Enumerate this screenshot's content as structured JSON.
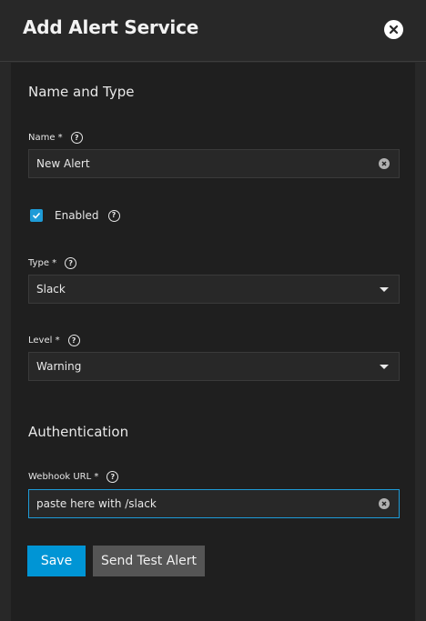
{
  "header": {
    "title": "Add Alert Service",
    "close_icon": "close-icon"
  },
  "sections": {
    "name_type": "Name and Type",
    "authentication": "Authentication"
  },
  "fields": {
    "name": {
      "label": "Name *",
      "value": "New Alert"
    },
    "enabled": {
      "label": "Enabled",
      "checked": true
    },
    "type": {
      "label": "Type *",
      "value": "Slack"
    },
    "level": {
      "label": "Level *",
      "value": "Warning"
    },
    "webhook": {
      "label": "Webhook URL *",
      "value": "paste here with /slack"
    }
  },
  "buttons": {
    "save": "Save",
    "test": "Send Test Alert"
  },
  "colors": {
    "accent": "#0095d5",
    "background": "#282828",
    "card": "#1f1f1f"
  }
}
